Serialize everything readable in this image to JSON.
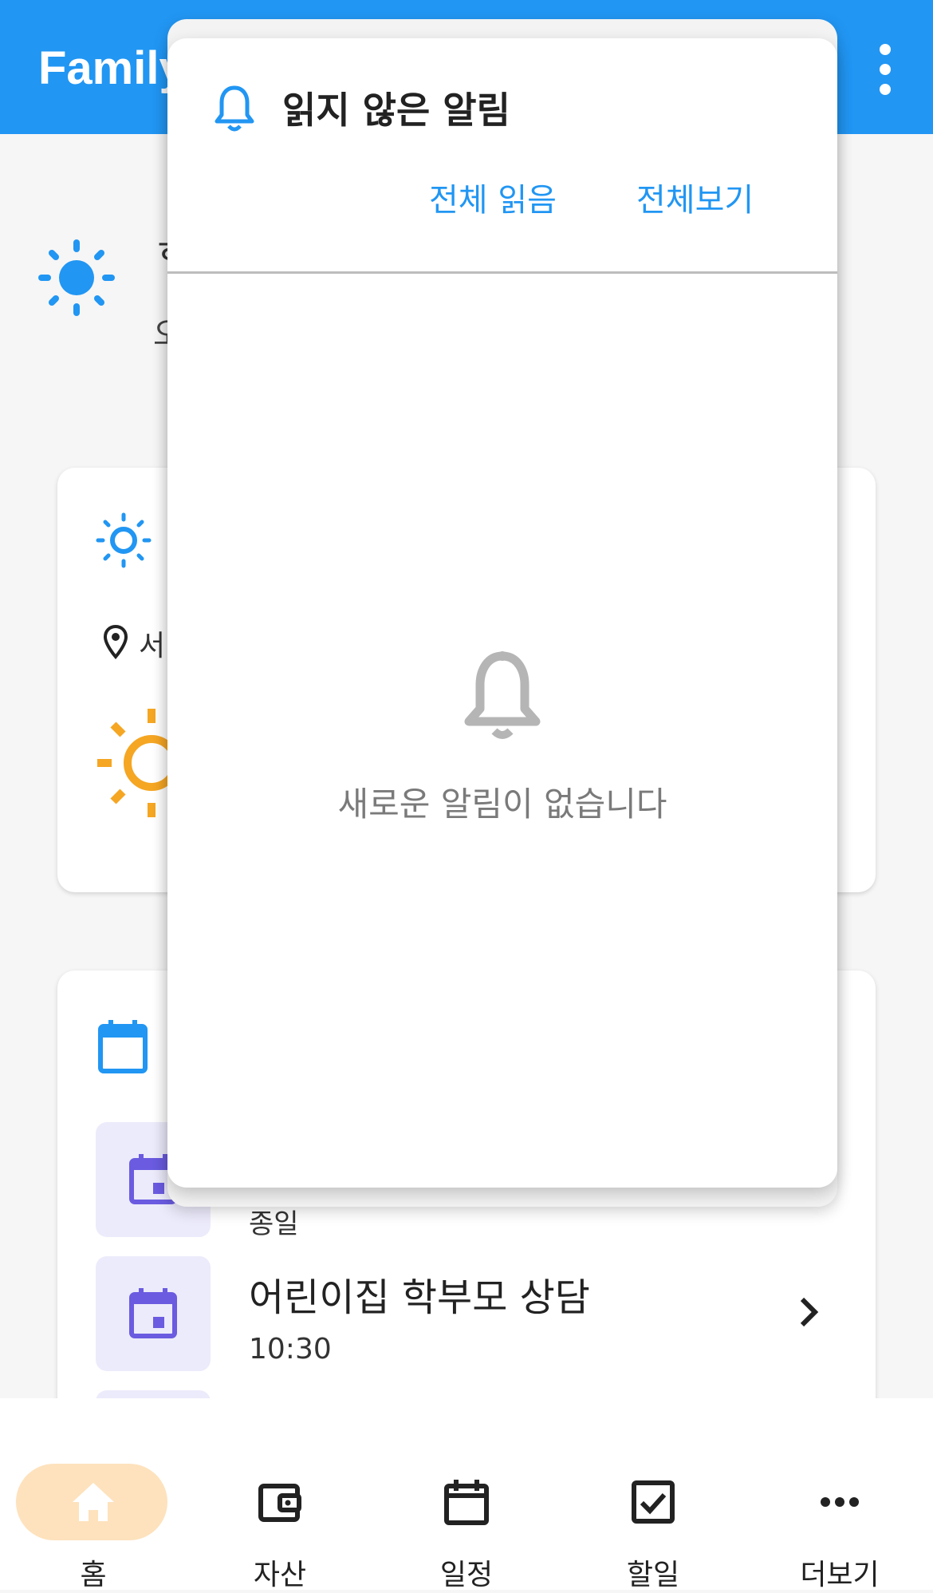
{
  "app": {
    "title": "Family",
    "menu_icon": "more-vert-icon",
    "primary_color": "#2196f3"
  },
  "background": {
    "greeting_fragment_top": "ㅎ",
    "greeting_fragment_bottom": "오",
    "location_fragment": "서",
    "schedule_items": [
      {
        "title": "",
        "subtitle": "종일"
      },
      {
        "title": "어린이집 학부모 상담",
        "subtitle": "10:30"
      }
    ]
  },
  "notifications_popup": {
    "title": "읽지 않은 알림",
    "read_all_label": "전체 읽음",
    "view_all_label": "전체보기",
    "empty_message": "새로운 알림이 없습니다"
  },
  "bottom_nav": {
    "active_color": "#fde2bd",
    "items": [
      {
        "label": "홈",
        "icon": "home-icon",
        "active": true
      },
      {
        "label": "자산",
        "icon": "wallet-icon",
        "active": false
      },
      {
        "label": "일정",
        "icon": "calendar-icon",
        "active": false
      },
      {
        "label": "할일",
        "icon": "checkbox-icon",
        "active": false
      },
      {
        "label": "더보기",
        "icon": "more-horiz-icon",
        "active": false
      }
    ]
  }
}
